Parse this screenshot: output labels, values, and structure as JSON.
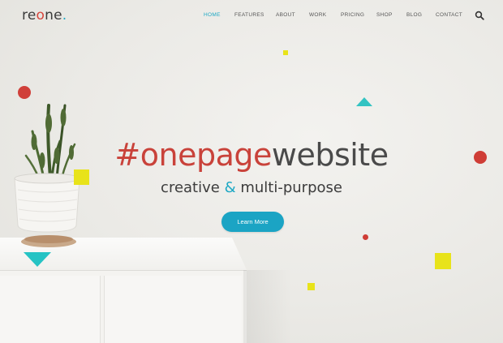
{
  "brand": {
    "logo_part1": "re",
    "logo_accent": "o",
    "logo_part2": "ne",
    "logo_dot": "."
  },
  "nav": {
    "items": [
      {
        "label": "HOME",
        "active": true
      },
      {
        "label": "FEATURES",
        "active": false
      },
      {
        "label": "ABOUT",
        "active": false
      },
      {
        "label": "WORK",
        "active": false
      },
      {
        "label": "PRICING",
        "active": false
      },
      {
        "label": "SHOP",
        "active": false
      },
      {
        "label": "BLOG",
        "active": false
      },
      {
        "label": "CONTACT",
        "active": false
      }
    ],
    "search_icon": "search-icon"
  },
  "hero": {
    "headline_accent": "#onepage",
    "headline_rest": "website",
    "subline_part1": "creative ",
    "subline_amp": "&",
    "subline_part2": " multi-purpose",
    "cta_label": "Learn More"
  },
  "colors": {
    "accent_teal": "#1da8c4",
    "accent_red": "#c9423a",
    "accent_yellow": "#e6e41a",
    "text_dark": "#4a4a4a",
    "background": "#ecebe7"
  }
}
